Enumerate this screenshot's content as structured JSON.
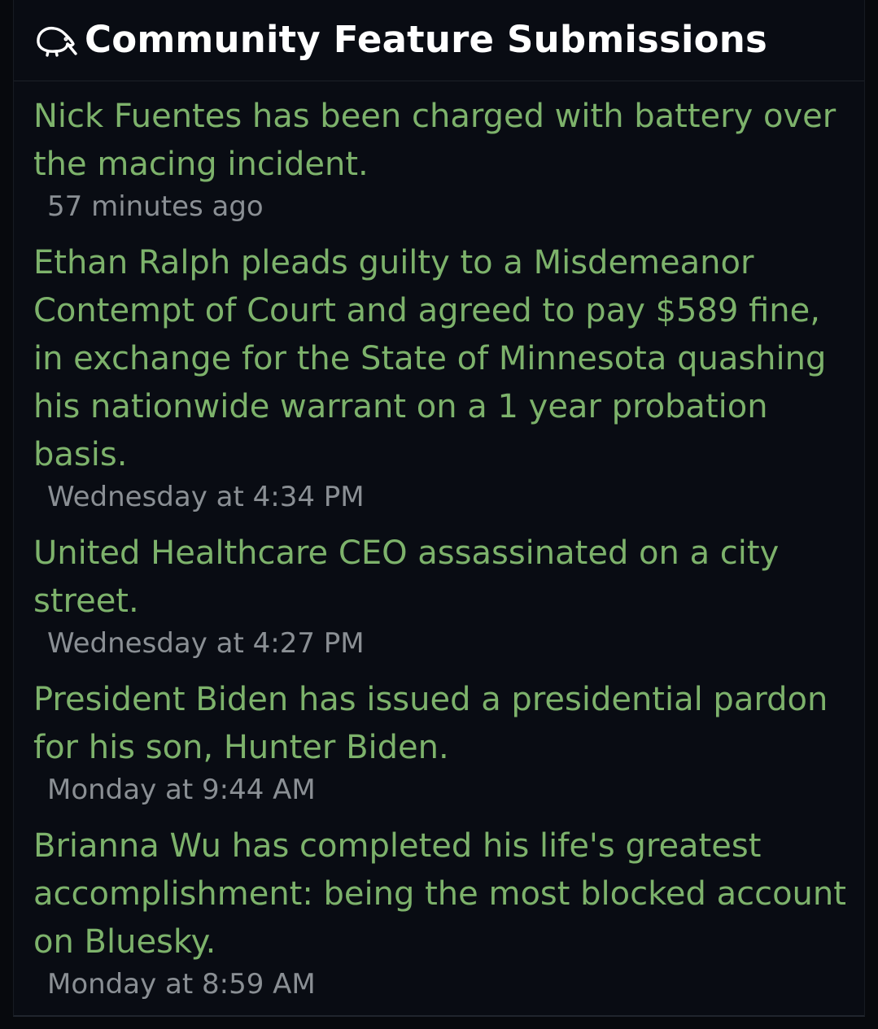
{
  "widget": {
    "title": "Community Feature Submissions",
    "icon": "kiwi-icon"
  },
  "submissions": [
    {
      "title": "Nick Fuentes has been charged with battery over the macing incident.",
      "time": "57 minutes ago"
    },
    {
      "title": "Ethan Ralph pleads guilty to a Misdemeanor Contempt of Court and agreed to pay $589 fine, in exchange for the State of Minnesota quashing his nationwide warrant on a 1 year probation basis.",
      "time": "Wednesday at 4:34 PM"
    },
    {
      "title": "United Healthcare CEO assassinated on a city street.",
      "time": "Wednesday at 4:27 PM"
    },
    {
      "title": "President Biden has issued a presidential pardon for his son, Hunter Biden.",
      "time": "Monday at 9:44 AM"
    },
    {
      "title": "Brianna Wu has completed his life's greatest accomplishment: being the most blocked account on Bluesky.",
      "time": "Monday at 8:59 AM"
    }
  ],
  "colors": {
    "link": "#7db26b",
    "time": "#8a8f94",
    "background": "#090c13"
  }
}
